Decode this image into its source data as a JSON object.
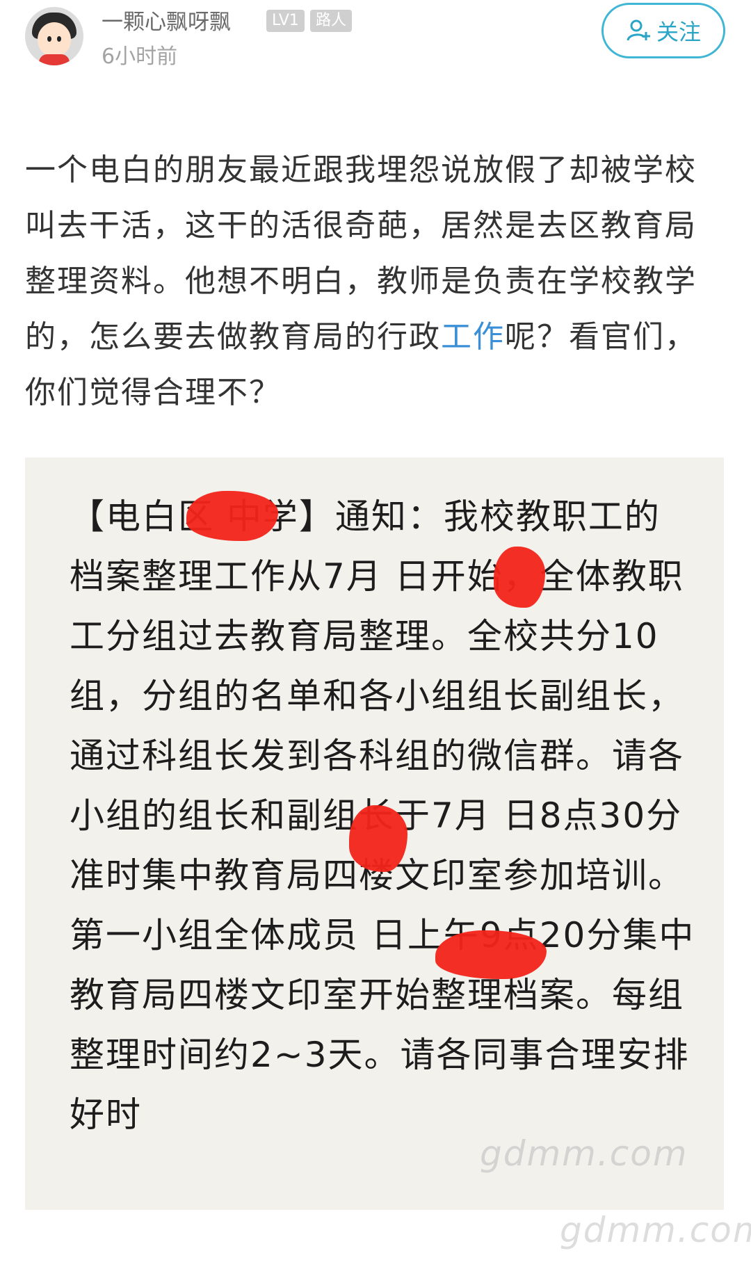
{
  "user": {
    "name": "一颗心飘呀飘",
    "level": "LV1",
    "role": "路人",
    "time": "6小时前"
  },
  "follow": {
    "label": "关注",
    "icon": "add-user-icon",
    "color": "#2aa5c7"
  },
  "post": {
    "text_main": "一个电白的朋友最近跟我埋怨说放假了却被学校叫去干活，这干的活很奇葩，居然是去区教育局整理资料。他想不明白，教师是负责在学校教学的，怎么要去做教育局的行政",
    "text_link": "工作",
    "text_tail": "呢？看官们，你们觉得合理不？",
    "link_color": "#3b8fd6"
  },
  "image": {
    "notice_text": "【电白区 中学】通知：我校教职工的档案整理工作从7月 日开始，全体教职工分组过去教育局整理。全校共分10组，分组的名单和各小组组长副组长，通过科组长发到各科组的微信群。请各小组的组长和副组长于7月 日8点30分准时集中教育局四楼文印室参加培训。第一小组全体成员 日上午9点20分集中教育局四楼文印室开始整理档案。每组整理时间约2~3天。请各同事合理安排好时",
    "redaction_color": "#f2241a"
  },
  "watermarks": {
    "mid": "gdmm.com",
    "bottom": "gdmm.com"
  }
}
